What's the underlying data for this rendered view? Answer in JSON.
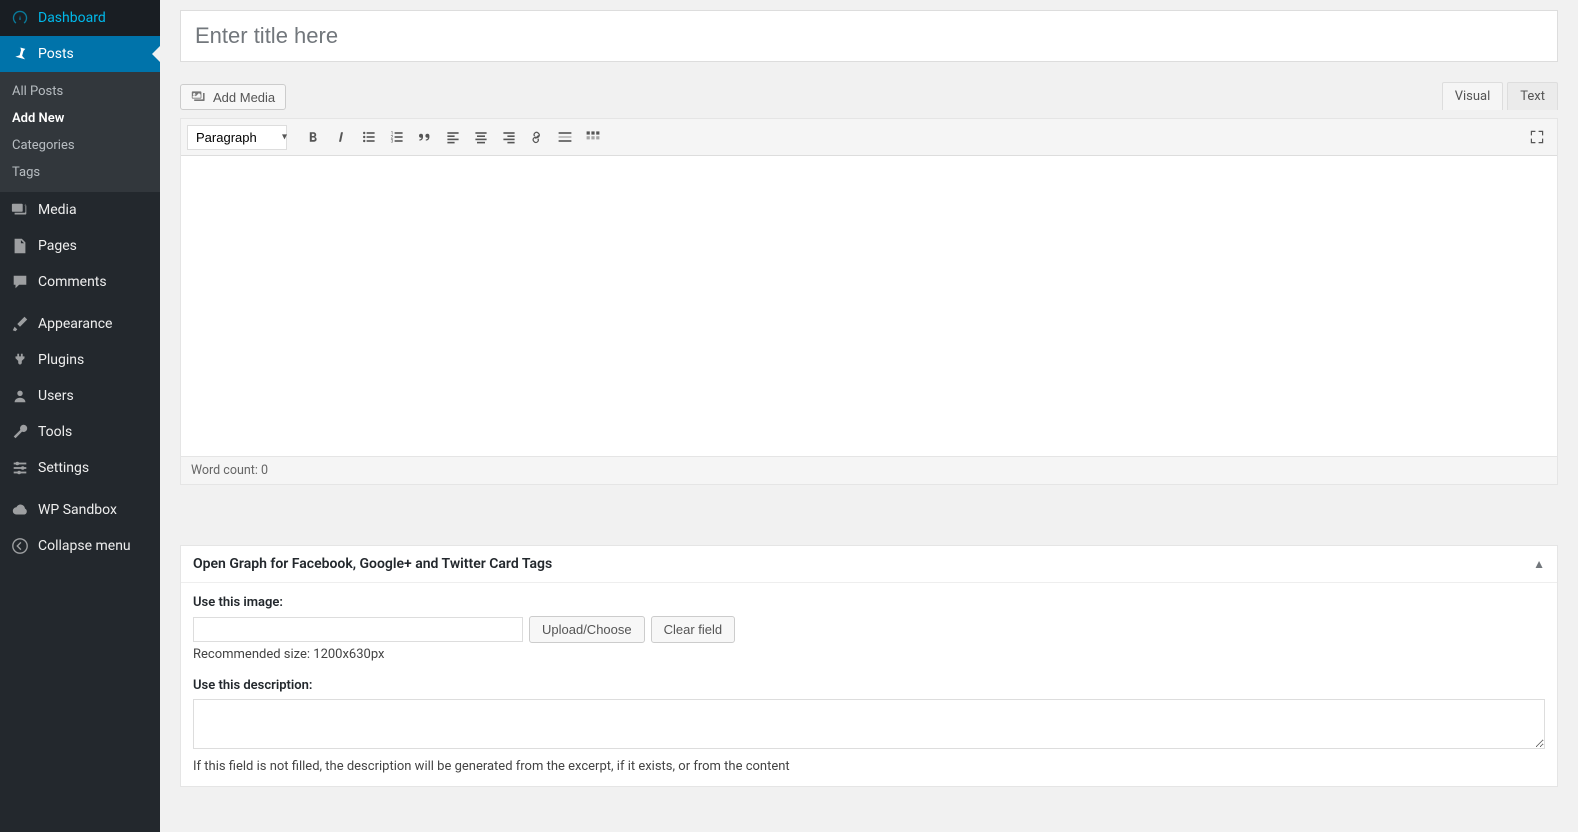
{
  "sidebar": {
    "items": [
      {
        "icon": "dashboard",
        "label": "Dashboard"
      },
      {
        "icon": "pin",
        "label": "Posts",
        "active": true,
        "sub": [
          {
            "label": "All Posts"
          },
          {
            "label": "Add New",
            "current": true
          },
          {
            "label": "Categories"
          },
          {
            "label": "Tags"
          }
        ]
      },
      {
        "icon": "media",
        "label": "Media"
      },
      {
        "icon": "page",
        "label": "Pages"
      },
      {
        "icon": "comment",
        "label": "Comments"
      },
      {
        "sep": true
      },
      {
        "icon": "brush",
        "label": "Appearance"
      },
      {
        "icon": "plug",
        "label": "Plugins"
      },
      {
        "icon": "user",
        "label": "Users"
      },
      {
        "icon": "wrench",
        "label": "Tools"
      },
      {
        "icon": "sliders",
        "label": "Settings"
      },
      {
        "sep": true
      },
      {
        "icon": "cloud",
        "label": "WP Sandbox"
      },
      {
        "icon": "collapse",
        "label": "Collapse menu"
      }
    ]
  },
  "editor": {
    "title_placeholder": "Enter title here",
    "add_media": "Add Media",
    "tabs": {
      "visual": "Visual",
      "text": "Text"
    },
    "format": "Paragraph",
    "word_count_label": "Word count: ",
    "word_count": "0"
  },
  "metabox": {
    "title": "Open Graph for Facebook, Google+ and Twitter Card Tags",
    "image_label": "Use this image:",
    "upload_btn": "Upload/Choose",
    "clear_btn": "Clear field",
    "recommended": "Recommended size: 1200x630px",
    "desc_label": "Use this description:",
    "desc_help": "If this field is not filled, the description will be generated from the excerpt, if it exists, or from the content"
  }
}
